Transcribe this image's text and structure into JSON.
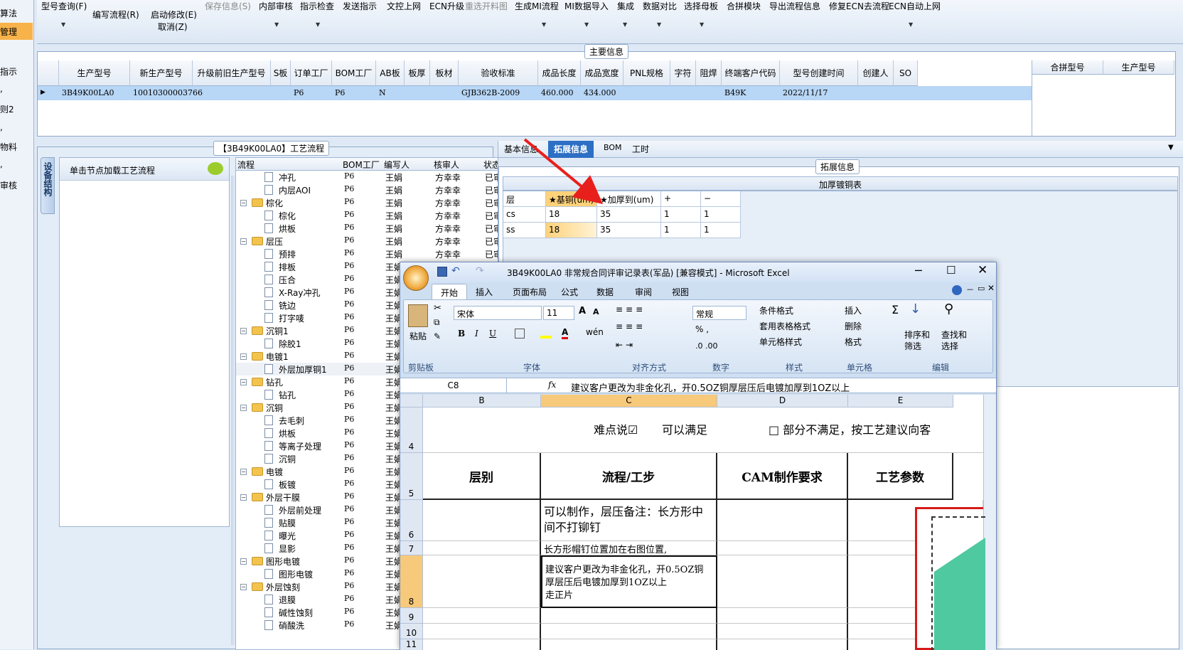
{
  "leftnav": {
    "items": [
      "算法",
      "管理",
      "指示",
      ",",
      "则2",
      ",",
      "物料",
      ",",
      "审核"
    ]
  },
  "toolbar": {
    "items": [
      {
        "label": "型号查询(F)",
        "disabled": false
      },
      {
        "label": "编写流程(R)",
        "disabled": false
      },
      {
        "label": "启动修改(E)",
        "disabled": false
      },
      {
        "label": "取消(Z)",
        "disabled": false
      },
      {
        "label": "保存信息(S)",
        "disabled": true
      },
      {
        "label": "内部审核",
        "disabled": false
      },
      {
        "label": "指示检查",
        "disabled": false
      },
      {
        "label": "发送指示",
        "disabled": false
      },
      {
        "label": "文控上网",
        "disabled": false
      },
      {
        "label": "ECN升级",
        "disabled": false
      },
      {
        "label": "重选开料图",
        "disabled": true
      },
      {
        "label": "生成MI流程",
        "disabled": false
      },
      {
        "label": "MI数据导入",
        "disabled": false
      },
      {
        "label": "集成",
        "disabled": false
      },
      {
        "label": "数据对比",
        "disabled": false
      },
      {
        "label": "选择母板",
        "disabled": false
      },
      {
        "label": "合拼模块",
        "disabled": false
      },
      {
        "label": "导出流程信息",
        "disabled": false
      },
      {
        "label": "修复ECN去流程",
        "disabled": false
      },
      {
        "label": "ECN自动上网",
        "disabled": false
      }
    ]
  },
  "main_info": {
    "title": "主要信息",
    "headers": [
      "生产型号",
      "新生产型号",
      "升级前旧生产型号",
      "S板",
      "订单工厂",
      "BOM工厂",
      "AB板",
      "板厚",
      "板材",
      "验收标准",
      "成品长度",
      "成品宽度",
      "PNL规格",
      "字符",
      "阻焊",
      "终端客户代码",
      "型号创建时间",
      "创建人",
      "SO"
    ],
    "row": [
      "3B49K00LA0",
      "10010300003766",
      "",
      "",
      "P6",
      "P6",
      "N",
      "",
      "",
      "GJB362B-2009",
      "460.000",
      "434.000",
      "",
      "",
      "",
      "B49K",
      "2022/11/17",
      "",
      ""
    ],
    "side_headers": [
      "合拼型号",
      "生产型号"
    ]
  },
  "process": {
    "title": "【3B49K00LA0】工艺流程",
    "vertical_tab": "设备结构",
    "load_node": "单击节点加载工艺流程",
    "headers": [
      "流程",
      "BOM工厂",
      "编写人",
      "核审人",
      "状态"
    ],
    "rows": [
      {
        "name": "冲孔",
        "level": 2,
        "folder": false,
        "bom": "P6",
        "writer": "王娟",
        "checker": "方幸幸",
        "status": "已审核"
      },
      {
        "name": "内层AOI",
        "level": 2,
        "folder": false,
        "bom": "P6",
        "writer": "王娟",
        "checker": "方幸幸",
        "status": "已审核"
      },
      {
        "name": "棕化",
        "level": 1,
        "folder": true,
        "bom": "P6",
        "writer": "王娟",
        "checker": "方幸幸",
        "status": "已审核"
      },
      {
        "name": "棕化",
        "level": 2,
        "folder": false,
        "bom": "P6",
        "writer": "王娟",
        "checker": "方幸幸",
        "status": "已审核"
      },
      {
        "name": "烘板",
        "level": 2,
        "folder": false,
        "bom": "P6",
        "writer": "王娟",
        "checker": "方幸幸",
        "status": "已审核"
      },
      {
        "name": "层压",
        "level": 1,
        "folder": true,
        "bom": "P6",
        "writer": "王娟",
        "checker": "方幸幸",
        "status": "已审核"
      },
      {
        "name": "预排",
        "level": 2,
        "folder": false,
        "bom": "P6",
        "writer": "王娟",
        "checker": "方幸幸",
        "status": "已审核"
      },
      {
        "name": "排板",
        "level": 2,
        "folder": false,
        "bom": "P6",
        "writer": "王娟",
        "checker": "方幸幸",
        "status": ""
      },
      {
        "name": "压合",
        "level": 2,
        "folder": false,
        "bom": "P6",
        "writer": "王娟",
        "checker": "",
        "status": ""
      },
      {
        "name": "X-Ray冲孔",
        "level": 2,
        "folder": false,
        "bom": "P6",
        "writer": "王娟",
        "checker": "",
        "status": ""
      },
      {
        "name": "铣边",
        "level": 2,
        "folder": false,
        "bom": "P6",
        "writer": "王娟",
        "checker": "",
        "status": ""
      },
      {
        "name": "打字唛",
        "level": 2,
        "folder": false,
        "bom": "P6",
        "writer": "王娟",
        "checker": "",
        "status": ""
      },
      {
        "name": "沉铜1",
        "level": 1,
        "folder": true,
        "bom": "P6",
        "writer": "王娟",
        "checker": "",
        "status": ""
      },
      {
        "name": "除胶1",
        "level": 2,
        "folder": false,
        "bom": "P6",
        "writer": "王娟",
        "checker": "",
        "status": ""
      },
      {
        "name": "电镀1",
        "level": 1,
        "folder": true,
        "bom": "P6",
        "writer": "王娟",
        "checker": "",
        "status": ""
      },
      {
        "name": "外层加厚铜1",
        "level": 2,
        "folder": false,
        "bom": "P6",
        "writer": "王娟",
        "checker": "",
        "status": ""
      },
      {
        "name": "钻孔",
        "level": 1,
        "folder": true,
        "bom": "P6",
        "writer": "王娟",
        "checker": "",
        "status": ""
      },
      {
        "name": "钻孔",
        "level": 2,
        "folder": false,
        "bom": "P6",
        "writer": "王娟",
        "checker": "",
        "status": ""
      },
      {
        "name": "沉铜",
        "level": 1,
        "folder": true,
        "bom": "P6",
        "writer": "王娟",
        "checker": "",
        "status": ""
      },
      {
        "name": "去毛刺",
        "level": 2,
        "folder": false,
        "bom": "P6",
        "writer": "王娟",
        "checker": "",
        "status": ""
      },
      {
        "name": "烘板",
        "level": 2,
        "folder": false,
        "bom": "P6",
        "writer": "王娟",
        "checker": "",
        "status": ""
      },
      {
        "name": "等离子处理",
        "level": 2,
        "folder": false,
        "bom": "P6",
        "writer": "王娟",
        "checker": "",
        "status": ""
      },
      {
        "name": "沉铜",
        "level": 2,
        "folder": false,
        "bom": "P6",
        "writer": "王娟",
        "checker": "",
        "status": ""
      },
      {
        "name": "电镀",
        "level": 1,
        "folder": true,
        "bom": "P6",
        "writer": "王娟",
        "checker": "",
        "status": ""
      },
      {
        "name": "板镀",
        "level": 2,
        "folder": false,
        "bom": "P6",
        "writer": "王娟",
        "checker": "",
        "status": ""
      },
      {
        "name": "外层干膜",
        "level": 1,
        "folder": true,
        "bom": "P6",
        "writer": "王娟",
        "checker": "",
        "status": ""
      },
      {
        "name": "外层前处理",
        "level": 2,
        "folder": false,
        "bom": "P6",
        "writer": "王娟",
        "checker": "",
        "status": ""
      },
      {
        "name": "贴膜",
        "level": 2,
        "folder": false,
        "bom": "P6",
        "writer": "王娟",
        "checker": "",
        "status": ""
      },
      {
        "name": "曝光",
        "level": 2,
        "folder": false,
        "bom": "P6",
        "writer": "王娟",
        "checker": "",
        "status": ""
      },
      {
        "name": "显影",
        "level": 2,
        "folder": false,
        "bom": "P6",
        "writer": "王娟",
        "checker": "",
        "status": ""
      },
      {
        "name": "图形电镀",
        "level": 1,
        "folder": true,
        "bom": "P6",
        "writer": "王娟",
        "checker": "",
        "status": ""
      },
      {
        "name": "图形电镀",
        "level": 2,
        "folder": false,
        "bom": "P6",
        "writer": "王娟",
        "checker": "",
        "status": ""
      },
      {
        "name": "外层蚀刻",
        "level": 1,
        "folder": true,
        "bom": "P6",
        "writer": "王娟",
        "checker": "",
        "status": ""
      },
      {
        "name": "退膜",
        "level": 2,
        "folder": false,
        "bom": "P6",
        "writer": "王娟",
        "checker": "",
        "status": ""
      },
      {
        "name": "碱性蚀刻",
        "level": 2,
        "folder": false,
        "bom": "P6",
        "writer": "王娟",
        "checker": "",
        "status": ""
      },
      {
        "name": "硝酸洗",
        "level": 2,
        "folder": false,
        "bom": "P6",
        "writer": "王娟",
        "checker": "",
        "status": ""
      }
    ]
  },
  "detail": {
    "tabs": [
      "基本信息",
      "拓展信息",
      "BOM",
      "工时"
    ],
    "active_tab": 1,
    "section_title": "拓展信息",
    "table_title": "加厚镀铜表",
    "headers": [
      "层",
      "★基铜(um)",
      "★加厚到(um)",
      "+",
      "−"
    ],
    "rows": [
      [
        "cs",
        "18",
        "35",
        "1",
        "1"
      ],
      [
        "ss",
        "18",
        "35",
        "1",
        "1"
      ]
    ]
  },
  "excel": {
    "title": "3B49K00LA0  非常规合同评审记录表(军品)  [兼容模式] - Microsoft Excel",
    "tabs": [
      "开始",
      "插入",
      "页面布局",
      "公式",
      "数据",
      "审阅",
      "视图"
    ],
    "ribbon": {
      "paste": "粘贴",
      "clipboard": "剪贴板",
      "font_name": "宋体",
      "font_size": "11",
      "font_group": "字体",
      "align_group": "对齐方式",
      "number_format": "常规",
      "number_group": "数字",
      "cond_format": "条件格式",
      "table_format": "套用表格格式",
      "cell_style": "单元格样式",
      "style_group": "样式",
      "insert": "插入",
      "delete": "删除",
      "format": "格式",
      "cells_group": "单元格",
      "sort": "排序和",
      "filter": "筛选",
      "find": "查找和",
      "select": "选择",
      "edit_group": "编辑"
    },
    "name_box": "C8",
    "fx": "fx",
    "formula": "建议客户更改为非金化孔，开0.5OZ铜厚层压后电镀加厚到1OZ以上",
    "columns": [
      "B",
      "C",
      "D",
      "E"
    ],
    "row_numbers": [
      "4",
      "5",
      "6",
      "7",
      "8",
      "9",
      "10",
      "11"
    ],
    "row4_a": "难点说☑",
    "row4_b": "可以满足",
    "row4_c": "□ 部分不满足，按工艺建议向客",
    "headers": [
      "层别",
      "流程/工步",
      "CAM制作要求",
      "工艺参数"
    ],
    "c6": "可以制作，层压备注：长方形中间不打铆钉",
    "c7": "长方形帽钉位置加在右图位置,",
    "c8_l1": "建议客户更改为非金化孔，开0.5OZ铜",
    "c8_l2": "厚层压后电镀加厚到1OZ以上",
    "c8_l3": "走正片"
  },
  "colors": {
    "accent": "#f7b34a",
    "selection": "#b8d6f5",
    "arrow": "#e8201c",
    "tab_active": "#2c6fc4"
  }
}
